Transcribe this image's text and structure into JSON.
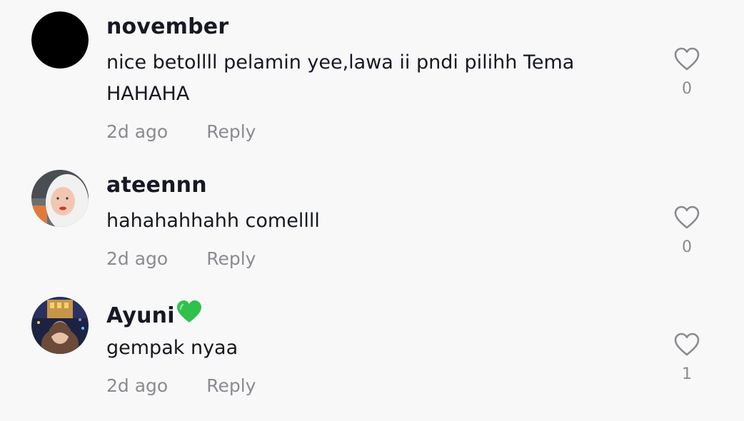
{
  "comments": [
    {
      "username": "november",
      "text": "nice betollll pelamin yee,lawa ii pndi pilihh Tema\nHAHAHA",
      "time": "2d ago",
      "reply_label": "Reply",
      "likes": "0",
      "avatar": "black-circle-avatar"
    },
    {
      "username": "ateennn",
      "text": "hahahahhahh comellll",
      "time": "2d ago",
      "reply_label": "Reply",
      "likes": "0",
      "avatar": "photo-avatar-hijab-white"
    },
    {
      "username": "Ayuni",
      "username_emoji": "green-heart-icon",
      "text": "gempak nyaa",
      "time": "2d ago",
      "reply_label": "Reply",
      "likes": "1",
      "avatar": "photo-avatar-night-city"
    }
  ],
  "icons": {
    "like": "heart-outline-icon",
    "like_color": "#8a8b91",
    "emoji_color": "#2fc14b"
  }
}
